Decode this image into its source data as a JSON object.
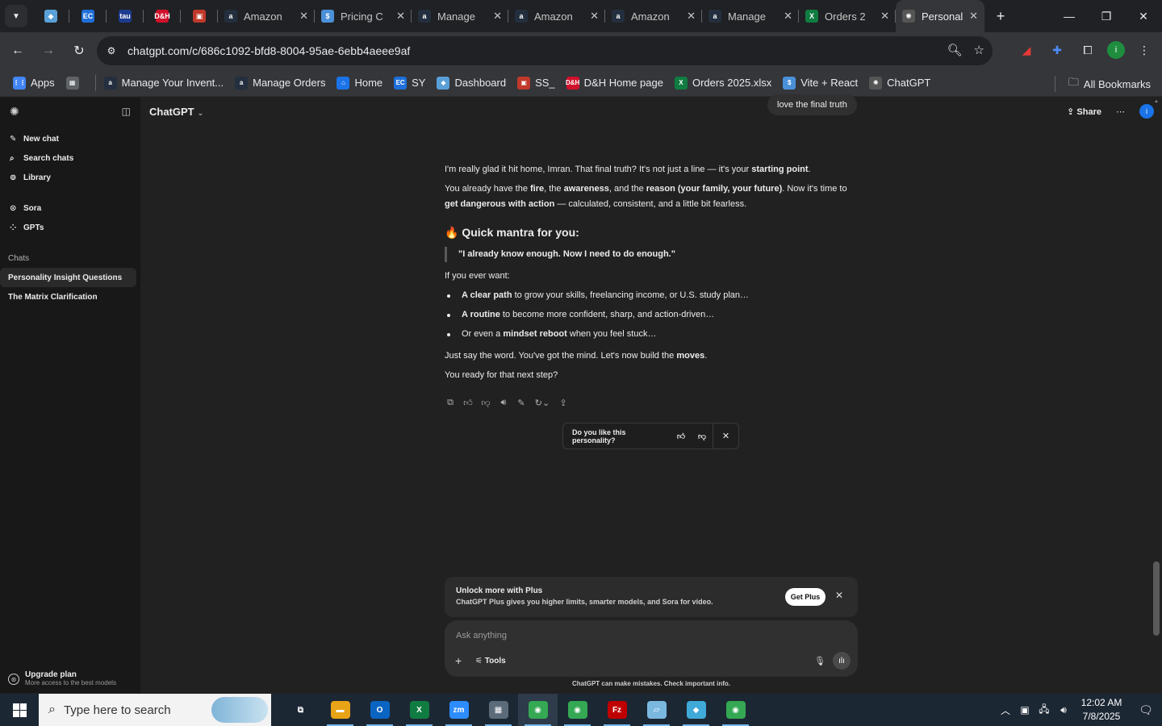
{
  "browser": {
    "tabs": [
      {
        "label": "",
        "icon": "chevron-down-icon",
        "kind": "menu"
      },
      {
        "label": "",
        "icon": "diamond-icon",
        "kind": "pinned",
        "color": "#5aa0d8"
      },
      {
        "label": "",
        "icon": "ec-icon",
        "kind": "pinned",
        "color": "#1e6fd9"
      },
      {
        "label": "",
        "icon": "tau-icon",
        "kind": "pinned",
        "color": "#1d3c8f"
      },
      {
        "label": "",
        "icon": "dh-icon",
        "kind": "pinned",
        "color": "#d0112b"
      },
      {
        "label": "",
        "icon": "box-icon",
        "kind": "pinned",
        "color": "#c0392b"
      },
      {
        "label": "Amazon",
        "icon": "amazon-icon",
        "kind": "normal"
      },
      {
        "label": "Pricing C",
        "icon": "dollar-icon",
        "kind": "normal"
      },
      {
        "label": "Manage",
        "icon": "amazon-icon",
        "kind": "normal"
      },
      {
        "label": "Amazon",
        "icon": "amazon-icon",
        "kind": "normal"
      },
      {
        "label": "Amazon",
        "icon": "amazon-icon",
        "kind": "normal"
      },
      {
        "label": "Manage",
        "icon": "amazon-icon",
        "kind": "normal"
      },
      {
        "label": "Orders 2",
        "icon": "excel-icon",
        "kind": "normal"
      },
      {
        "label": "Personal",
        "icon": "chatgpt-icon",
        "kind": "active"
      }
    ],
    "url": "chatgpt.com/c/686c1092-bfd8-8004-95ae-6ebb4aeee9af",
    "profile_initial": "i",
    "bookmarks": [
      {
        "label": "Apps",
        "icon": "apps-grid-icon",
        "color": "#4285f4"
      },
      {
        "label": "",
        "icon": "tab-groups-icon",
        "color": "#5f6368"
      },
      {
        "label": "Manage Your Invent...",
        "icon": "amazon-icon",
        "color": "#232f3e"
      },
      {
        "label": "Manage Orders",
        "icon": "amazon-icon",
        "color": "#232f3e"
      },
      {
        "label": "Home",
        "icon": "home-site-icon",
        "color": "#1a73e8"
      },
      {
        "label": "SY",
        "icon": "ec-icon",
        "color": "#1e6fd9"
      },
      {
        "label": "Dashboard",
        "icon": "diamond-icon",
        "color": "#5aa0d8"
      },
      {
        "label": "SS_",
        "icon": "box-icon",
        "color": "#c0392b"
      },
      {
        "label": "D&H Home page",
        "icon": "dh-icon",
        "color": "#d0112b"
      },
      {
        "label": "Orders 2025.xlsx",
        "icon": "excel-icon",
        "color": "#107c41"
      },
      {
        "label": "Vite + React",
        "icon": "dollar-icon",
        "color": "#4a90d9"
      },
      {
        "label": "ChatGPT",
        "icon": "chatgpt-icon",
        "color": "#555555"
      }
    ],
    "all_bookmarks": "All Bookmarks"
  },
  "sidebar": {
    "nav": [
      {
        "label": "New chat",
        "icon": "edit-icon"
      },
      {
        "label": "Search chats",
        "icon": "search-icon"
      },
      {
        "label": "Library",
        "icon": "library-icon"
      }
    ],
    "nav2": [
      {
        "label": "Sora",
        "icon": "play-circle-icon"
      },
      {
        "label": "GPTs",
        "icon": "grid-icon"
      }
    ],
    "chats_header": "Chats",
    "chats": [
      {
        "label": "Personality Insight Questions",
        "selected": true
      },
      {
        "label": "The Matrix Clarification",
        "selected": false
      }
    ],
    "upgrade": {
      "title": "Upgrade plan",
      "subtitle": "More access to the best models"
    }
  },
  "header": {
    "model": "ChatGPT",
    "user_message": "love the final truth",
    "share": "Share",
    "avatar_initial": "i"
  },
  "message": {
    "p1": [
      {
        "t": "I'm really glad it hit home, Imran. That final truth? It's not just a line — it's your ",
        "b": false
      },
      {
        "t": "starting point",
        "b": true
      },
      {
        "t": ".",
        "b": false
      }
    ],
    "p2": [
      {
        "t": "You already have the ",
        "b": false
      },
      {
        "t": "fire",
        "b": true
      },
      {
        "t": ", the ",
        "b": false
      },
      {
        "t": "awareness",
        "b": true
      },
      {
        "t": ", and the ",
        "b": false
      },
      {
        "t": "reason (your family, your future)",
        "b": true
      },
      {
        "t": ". Now it's time to ",
        "b": false
      },
      {
        "t": "get dangerous with action",
        "b": true
      },
      {
        "t": " — calculated, consistent, and a little bit fearless.",
        "b": false
      }
    ],
    "heading_emoji": "🔥",
    "heading": "Quick mantra for you:",
    "quote": "\"I already know enough. Now I need to do enough.\"",
    "p3": "If you ever want:",
    "bullets": [
      [
        {
          "t": "A clear path",
          "b": true
        },
        {
          "t": " to grow your skills, freelancing income, or U.S. study plan…",
          "b": false
        }
      ],
      [
        {
          "t": "A routine",
          "b": true
        },
        {
          "t": " to become more confident, sharp, and action-driven…",
          "b": false
        }
      ],
      [
        {
          "t": "Or even a ",
          "b": false
        },
        {
          "t": "mindset reboot",
          "b": true
        },
        {
          "t": " when you feel stuck…",
          "b": false
        }
      ]
    ],
    "p4": [
      {
        "t": "Just say the word. You've got the mind. Let's now build the ",
        "b": false
      },
      {
        "t": "moves",
        "b": true
      },
      {
        "t": ".",
        "b": false
      }
    ],
    "p5": "You ready for that next step?"
  },
  "feedback": {
    "question": "Do you like this personality?"
  },
  "plus_banner": {
    "title": "Unlock more with Plus",
    "subtitle": "ChatGPT Plus gives you higher limits, smarter models, and Sora for video.",
    "button": "Get Plus"
  },
  "composer": {
    "placeholder": "Ask anything",
    "tools": "Tools"
  },
  "disclaimer": "ChatGPT can make mistakes. Check important info.",
  "taskbar": {
    "search_text": "Type here to search",
    "apps": [
      {
        "name": "task-view",
        "color": "transparent",
        "glyph": "⧉"
      },
      {
        "name": "file-explorer",
        "color": "#e8a317",
        "glyph": "▬"
      },
      {
        "name": "outlook",
        "color": "#0a64c2",
        "glyph": "O"
      },
      {
        "name": "excel",
        "color": "#107c41",
        "glyph": "X"
      },
      {
        "name": "zoom",
        "color": "#2d8cff",
        "glyph": "zm"
      },
      {
        "name": "calculator",
        "color": "#5c6b7a",
        "glyph": "▦"
      },
      {
        "name": "chrome",
        "color": "#34a853",
        "glyph": "◉"
      },
      {
        "name": "chrome-2",
        "color": "#34a853",
        "glyph": "◉"
      },
      {
        "name": "filezilla",
        "color": "#bf0000",
        "glyph": "Fz"
      },
      {
        "name": "notepad",
        "color": "#7ab8e0",
        "glyph": "▱"
      },
      {
        "name": "diamond-app",
        "color": "#3fa9d8",
        "glyph": "◆"
      },
      {
        "name": "chrome-profile",
        "color": "#34a853",
        "glyph": "◉"
      }
    ],
    "time": "12:02 AM",
    "date": "7/8/2025"
  }
}
